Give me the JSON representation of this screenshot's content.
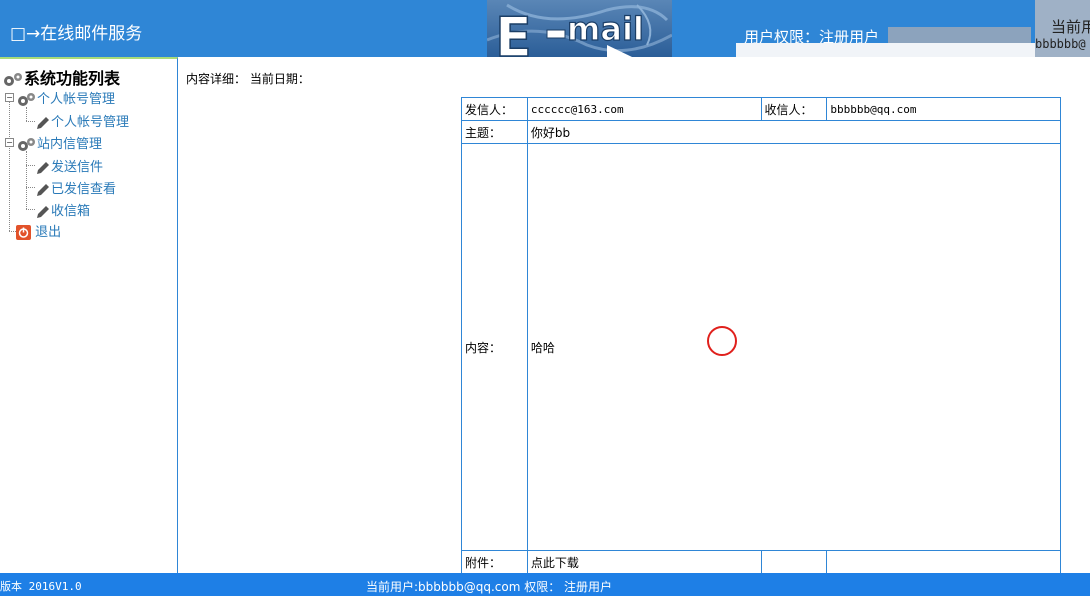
{
  "header": {
    "app_title": "□→在线邮件服务",
    "banner_text": "E-mail",
    "permission_label": "用户权限：注册用户",
    "current_user_label": "当前用",
    "current_user_value": "bbbbbb@"
  },
  "sidebar": {
    "title": "系统功能列表",
    "groups": [
      {
        "label": "个人帐号管理",
        "items": [
          "个人帐号管理"
        ]
      },
      {
        "label": "站内信管理",
        "items": [
          "发送信件",
          "已发信查看",
          "收信箱"
        ]
      }
    ],
    "logout": "退出"
  },
  "main": {
    "detail_label": "内容详细：",
    "date_label": "当前日期："
  },
  "mail": {
    "from_label": "发信人：",
    "from_value": "cccccc@163.com",
    "to_label": "收信人：",
    "to_value": "bbbbbb@qq.com",
    "subject_label": "主题：",
    "subject_value": "你好bb",
    "content_label": "内容：",
    "content_value": "哈哈",
    "attachment_label": "附件：",
    "attachment_value": "点此下载"
  },
  "footer": {
    "version": "版本 2016V1.0",
    "current_user": "当前用户:bbbbbb@qq.com 权限： 注册用户"
  },
  "colors": {
    "header_bg": "#2f86d6",
    "footer_bg": "#1e7fe6",
    "link": "#2a7ab8",
    "border": "#2f86d6"
  }
}
